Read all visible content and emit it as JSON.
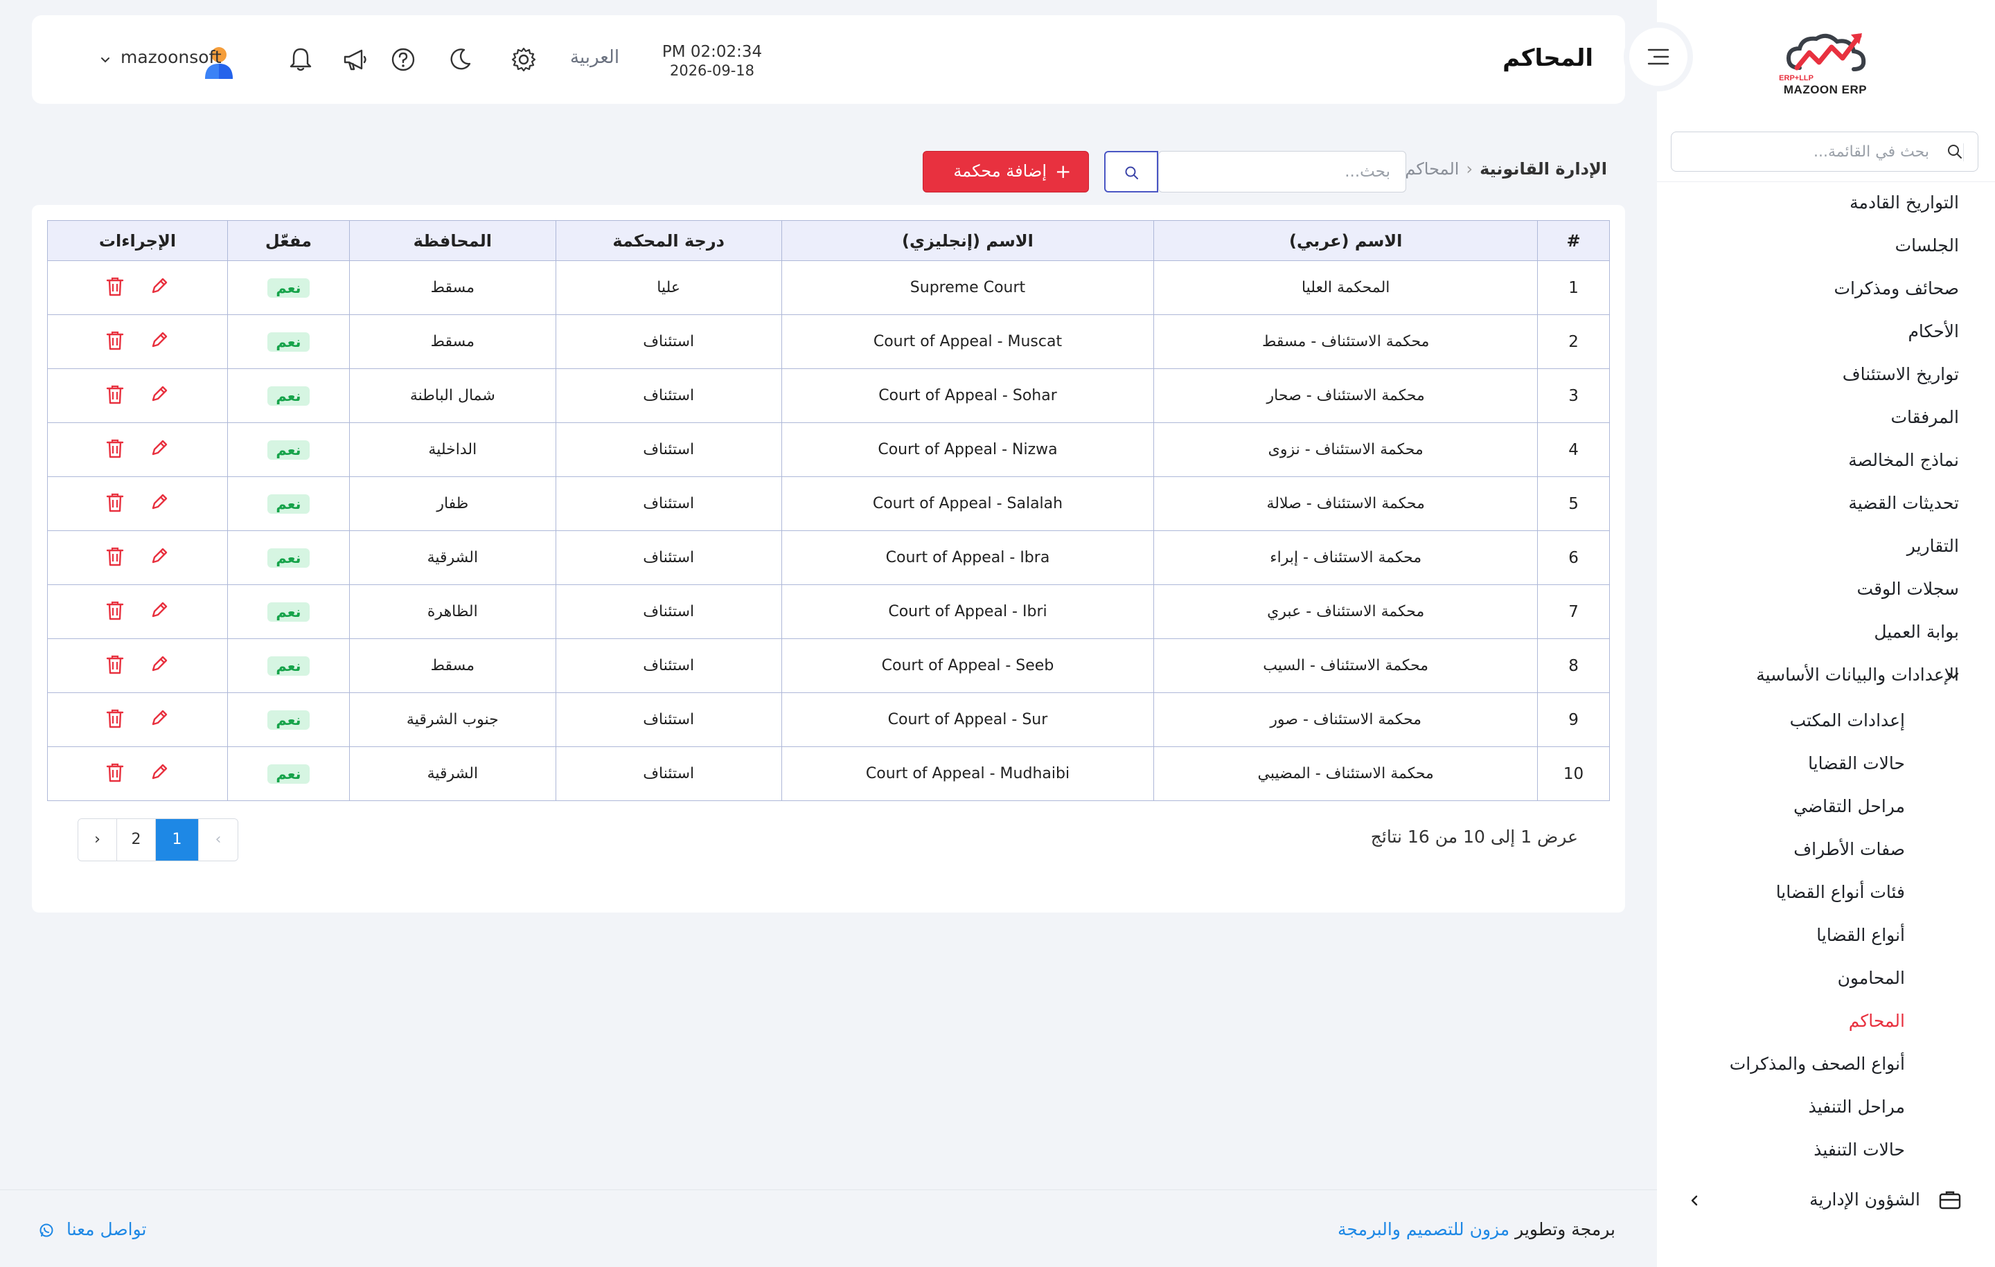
{
  "app": {
    "brand": "MAZOON ERP",
    "brand_small": "ERP+LLP"
  },
  "sidebar": {
    "search_placeholder": "بحث في القائمة...",
    "items": [
      {
        "label": "التواريخ القادمة"
      },
      {
        "label": "الجلسات"
      },
      {
        "label": "صحائف ومذكرات"
      },
      {
        "label": "الأحكام"
      },
      {
        "label": "تواريخ الاستئناف"
      },
      {
        "label": "المرفقات"
      },
      {
        "label": "نماذج المخالصة"
      },
      {
        "label": "تحديثات القضية"
      },
      {
        "label": "التقارير"
      },
      {
        "label": "سجلات الوقت"
      },
      {
        "label": "بوابة العميل"
      },
      {
        "label": "الإعدادات والبيانات الأساسية"
      },
      {
        "label": "إعدادات المكتب"
      },
      {
        "label": "حالات القضايا"
      },
      {
        "label": "مراحل التقاضي"
      },
      {
        "label": "صفات الأطراف"
      },
      {
        "label": "فئات أنواع القضايا"
      },
      {
        "label": "أنواع القضايا"
      },
      {
        "label": "المحامون"
      },
      {
        "label": "المحاكم"
      },
      {
        "label": "أنواع الصحف والمذكرات"
      },
      {
        "label": "مراحل التنفيذ"
      },
      {
        "label": "حالات التنفيذ"
      },
      {
        "label": "الشؤون الإدارية"
      }
    ]
  },
  "header": {
    "title": "المحاكم",
    "time": "PM 02:02:34",
    "date": "2026-09-18",
    "language": "العربية",
    "username": "mazoonsoft"
  },
  "toolbar": {
    "breadcrumb_root": "الإدارة القانونية",
    "breadcrumb_current": "المحاكم",
    "search_placeholder": "بحث...",
    "add_label": "إضافة محكمة"
  },
  "table": {
    "columns": [
      "#",
      "الاسم (عربي)",
      "الاسم (إنجليزي)",
      "درجة المحكمة",
      "المحافظة",
      "مفعّل",
      "الإجراءات"
    ],
    "rows": [
      {
        "n": "1",
        "ar": "المحكمة العليا",
        "en": "Supreme Court",
        "level": "عليا",
        "gov": "مسقط",
        "active": "نعم"
      },
      {
        "n": "2",
        "ar": "محكمة الاستئناف - مسقط",
        "en": "Court of Appeal - Muscat",
        "level": "استئناف",
        "gov": "مسقط",
        "active": "نعم"
      },
      {
        "n": "3",
        "ar": "محكمة الاستئناف - صحار",
        "en": "Court of Appeal - Sohar",
        "level": "استئناف",
        "gov": "شمال الباطنة",
        "active": "نعم"
      },
      {
        "n": "4",
        "ar": "محكمة الاستئناف - نزوى",
        "en": "Court of Appeal - Nizwa",
        "level": "استئناف",
        "gov": "الداخلية",
        "active": "نعم"
      },
      {
        "n": "5",
        "ar": "محكمة الاستئناف - صلالة",
        "en": "Court of Appeal - Salalah",
        "level": "استئناف",
        "gov": "ظفار",
        "active": "نعم"
      },
      {
        "n": "6",
        "ar": "محكمة الاستئناف - إبراء",
        "en": "Court of Appeal - Ibra",
        "level": "استئناف",
        "gov": "الشرقية",
        "active": "نعم"
      },
      {
        "n": "7",
        "ar": "محكمة الاستئناف - عبري",
        "en": "Court of Appeal - Ibri",
        "level": "استئناف",
        "gov": "الظاهرة",
        "active": "نعم"
      },
      {
        "n": "8",
        "ar": "محكمة الاستئناف - السيب",
        "en": "Court of Appeal - Seeb",
        "level": "استئناف",
        "gov": "مسقط",
        "active": "نعم"
      },
      {
        "n": "9",
        "ar": "محكمة الاستئناف - صور",
        "en": "Court of Appeal - Sur",
        "level": "استئناف",
        "gov": "جنوب الشرقية",
        "active": "نعم"
      },
      {
        "n": "10",
        "ar": "محكمة الاستئناف - المضيبي",
        "en": "Court of Appeal - Mudhaibi",
        "level": "استئناف",
        "gov": "الشرقية",
        "active": "نعم"
      }
    ]
  },
  "pagination": {
    "summary": "عرض 1 إلى 10 من 16 نتائج",
    "prev": "‹",
    "pages": [
      "1",
      "2"
    ],
    "next": "›",
    "current": "1"
  },
  "footer": {
    "credit_prefix": "برمجة وتطوير",
    "credit_link": "مزون للتصميم والبرمجة",
    "contact": "تواصل معنا"
  },
  "colors": {
    "accent": "#e8313f",
    "primary": "#1e88e5",
    "success": "#16a34a"
  },
  "icons": [
    "search-icon",
    "hamburger-icon",
    "bell-icon",
    "megaphone-icon",
    "help-icon",
    "moon-icon",
    "gear-icon",
    "user-avatar",
    "pencil-icon",
    "trash-icon",
    "briefcase-icon",
    "whatsapp-icon",
    "chevron-down-icon",
    "chevron-left-icon"
  ]
}
